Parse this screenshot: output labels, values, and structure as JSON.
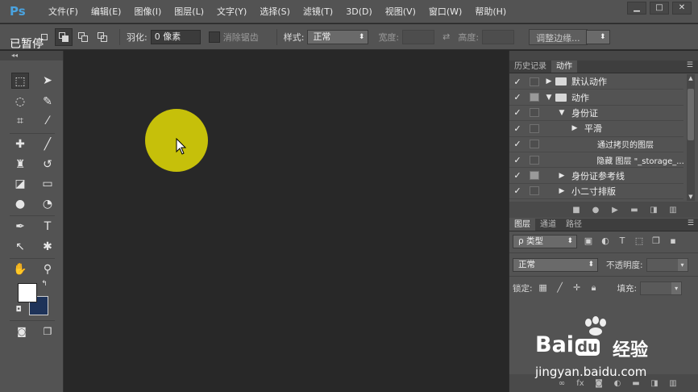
{
  "app": {
    "logo": "Ps",
    "paused_label": "已暂停"
  },
  "menu": [
    "文件(F)",
    "编辑(E)",
    "图像(I)",
    "图层(L)",
    "文字(Y)",
    "选择(S)",
    "滤镜(T)",
    "3D(D)",
    "视图(V)",
    "窗口(W)",
    "帮助(H)"
  ],
  "window_controls": [
    "▁",
    "□",
    "✕"
  ],
  "options": {
    "feather_label": "羽化:",
    "feather_value": "0 像素",
    "antialias_label": "消除锯齿",
    "style_label": "样式:",
    "style_value": "正常",
    "width_label": "宽度:",
    "height_label": "高度:",
    "refine_button": "调整边缘..."
  },
  "actions_panel": {
    "tabs": [
      "历史记录",
      "动作"
    ],
    "active_tab": "动作",
    "rows": [
      {
        "label": "默认动作",
        "indent": 0,
        "expanded": false,
        "folder": true,
        "box_on": false
      },
      {
        "label": "动作",
        "indent": 0,
        "expanded": true,
        "folder": true,
        "box_on": true
      },
      {
        "label": "身份证",
        "indent": 1,
        "expanded": true,
        "folder": false,
        "box_on": false
      },
      {
        "label": "平滑",
        "indent": 2,
        "expanded": false,
        "folder": false,
        "box_on": false
      },
      {
        "label": "通过拷贝的图层",
        "indent": 3,
        "expanded": null,
        "folder": false,
        "box_on": false
      },
      {
        "label": "隐藏 图层 \"_storage_...",
        "indent": 3,
        "expanded": null,
        "folder": false,
        "box_on": false
      },
      {
        "label": "身份证参考线",
        "indent": 1,
        "expanded": false,
        "folder": false,
        "box_on": true
      },
      {
        "label": "小二寸排版",
        "indent": 1,
        "expanded": false,
        "folder": false,
        "box_on": false
      }
    ]
  },
  "layers_panel": {
    "tabs": [
      "图层",
      "通道",
      "路径"
    ],
    "active_tab": "图层",
    "filter_value": "ρ 类型",
    "blend_value": "正常",
    "opacity_label": "不透明度:",
    "lock_label": "锁定:",
    "fill_label": "填充:"
  },
  "colors": {
    "foreground": "#ffffff",
    "background": "#1e3359",
    "dot": "#c6c00a"
  },
  "watermark": {
    "brand": "Bai",
    "brand2": "du",
    "brand_cn": "经验",
    "url": "jingyan.baidu.com"
  }
}
